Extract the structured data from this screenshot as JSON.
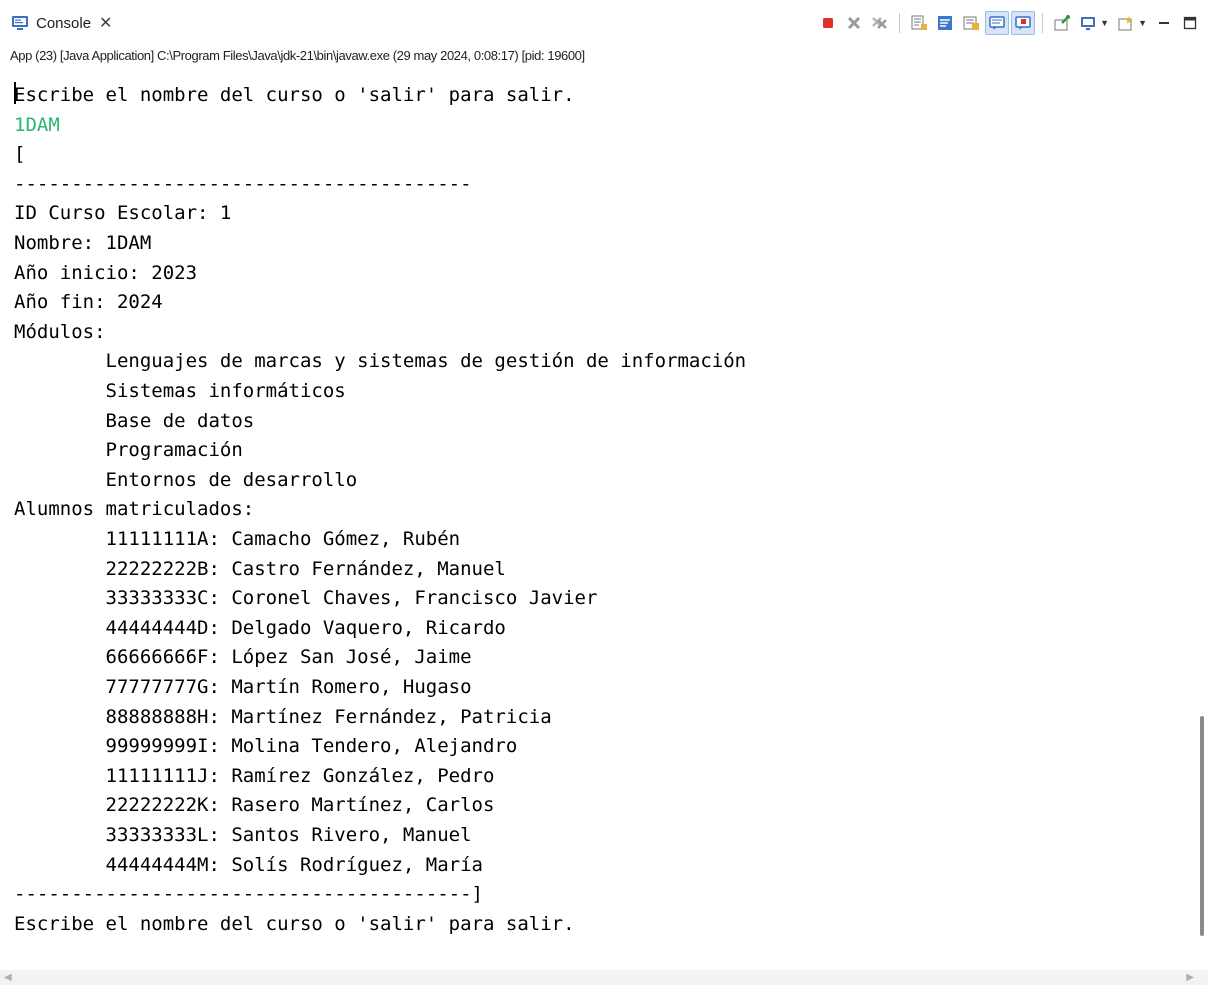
{
  "tab": {
    "label": "Console",
    "close": "✕"
  },
  "toolbar": {
    "buttons": [
      {
        "name": "terminate-icon"
      },
      {
        "name": "remove-launch-icon"
      },
      {
        "name": "remove-all-terminated-icon"
      },
      {
        "name": "scroll-lock-icon"
      },
      {
        "name": "word-wrap-icon"
      },
      {
        "name": "show-on-output-icon"
      },
      {
        "name": "show-on-stdout-icon"
      },
      {
        "name": "show-on-stderr-icon"
      },
      {
        "name": "pin-console-icon"
      },
      {
        "name": "display-console-icon"
      },
      {
        "name": "open-console-icon"
      },
      {
        "name": "minimize-icon"
      },
      {
        "name": "maximize-icon"
      }
    ]
  },
  "process_label": "App (23) [Java Application] C:\\Program Files\\Java\\jdk-21\\bin\\javaw.exe  (29 may 2024, 0:08:17) [pid: 19600]",
  "console_lines": [
    "Escribe el nombre del curso o 'salir' para salir.",
    "1DAM",
    "[",
    "----------------------------------------",
    "ID Curso Escolar: 1",
    "Nombre: 1DAM",
    "Año inicio: 2023",
    "Año fin: 2024",
    "Módulos:",
    "        Lenguajes de marcas y sistemas de gestión de información",
    "        Sistemas informáticos",
    "        Base de datos",
    "        Programación",
    "        Entornos de desarrollo",
    "Alumnos matriculados:",
    "        11111111A: Camacho Gómez, Rubén",
    "        22222222B: Castro Fernández, Manuel",
    "        33333333C: Coronel Chaves, Francisco Javier",
    "        44444444D: Delgado Vaquero, Ricardo",
    "        66666666F: López San José, Jaime",
    "        77777777G: Martín Romero, Hugaso",
    "        88888888H: Martínez Fernández, Patricia",
    "        99999999I: Molina Tendero, Alejandro",
    "        11111111J: Ramírez González, Pedro",
    "        22222222K: Rasero Martínez, Carlos",
    "        33333333L: Santos Rivero, Manuel",
    "        44444444M: Solís Rodríguez, María",
    "----------------------------------------]",
    "Escribe el nombre del curso o 'salir' para salir."
  ],
  "colors": {
    "input_text": "#2bb673",
    "stdout_text": "#000000"
  }
}
